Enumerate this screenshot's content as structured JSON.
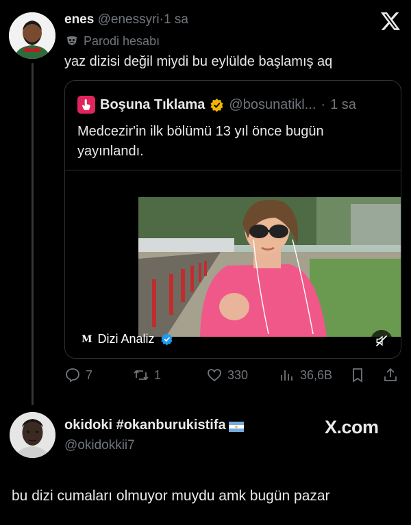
{
  "tweet": {
    "author_name": "enes",
    "author_handle": "@enessyri",
    "separator": "·",
    "time": "1 sa",
    "parody_label": "Parodi hesabı",
    "text": "yaz dizisi değil miydi bu eylülde başlamış aq",
    "platform_icon": "x-logo-icon"
  },
  "quote": {
    "author_name": "Boşuna Tıklama",
    "author_handle": "@bosunatikl...",
    "separator": "·",
    "time": "1 sa",
    "text": "Medcezir'in ilk bölümü 13 yıl önce bugün yayınlandı.",
    "media_source": "Dizi Analiz",
    "media_source_logo": "M",
    "badge_color": "#f4b400",
    "verified_color": "#1d9bf0"
  },
  "actions": {
    "replies": "7",
    "retweets": "1",
    "likes": "330",
    "views": "36,6B"
  },
  "reply": {
    "author_name": "okidoki #okanburukistifa",
    "author_handle": "@okidokkii7",
    "watermark": "X.com",
    "text": "bu dizi cumaları olmuyor muydu amk bugün pazar"
  }
}
